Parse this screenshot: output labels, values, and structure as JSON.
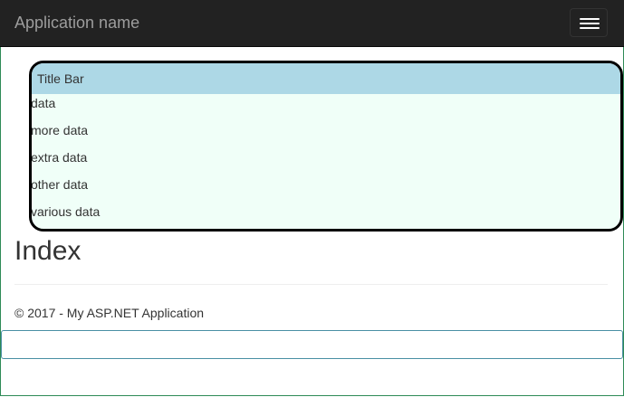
{
  "navbar": {
    "brand": "Application name",
    "toggle_icon": "hamburger-menu-icon"
  },
  "panel": {
    "title": "Title Bar",
    "rows": [
      "data",
      "more data",
      "extra data",
      "other data",
      "various data"
    ],
    "colors": {
      "title_bg": "#add8e6",
      "body_bg": "#f0fff8",
      "border": "#000000"
    }
  },
  "main": {
    "heading": "Index"
  },
  "footer": {
    "text": "© 2017 - My ASP.NET Application"
  },
  "bottom_field": {
    "value": ""
  }
}
